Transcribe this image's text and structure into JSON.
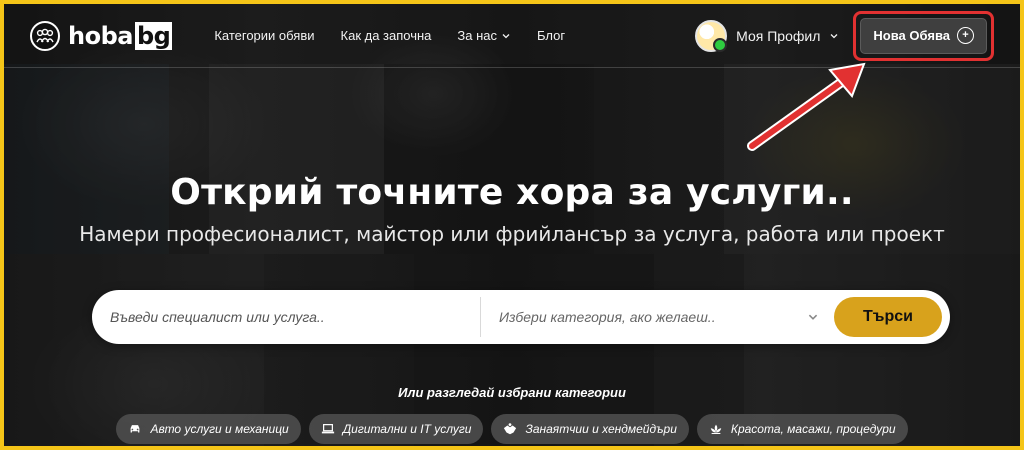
{
  "brand": {
    "logo_pre": "hoba",
    "logo_tag": "bg"
  },
  "nav": {
    "items": [
      {
        "label": "Категории обяви"
      },
      {
        "label": "Как да започна"
      },
      {
        "label": "За нас"
      },
      {
        "label": "Блог"
      }
    ],
    "profile_label": "Моя Профил",
    "new_ad_label": "Нова Обява"
  },
  "hero": {
    "headline": "Открий точните хора за услуги..",
    "subline": "Намери професионалист, майстор или фрийлансър за услуга, работа или проект"
  },
  "search": {
    "placeholder": "Въведи специалист или услуга..",
    "category_placeholder": "Избери категория, ако желаеш..",
    "button_label": "Търси"
  },
  "featured": {
    "heading": "Или разгледай избрани категории",
    "categories": [
      {
        "label": "Авто услуги и механици",
        "icon": "car-icon"
      },
      {
        "label": "Дигитални и IT услуги",
        "icon": "laptop-icon"
      },
      {
        "label": "Занаятчии и хендмейдъри",
        "icon": "handshake-icon"
      },
      {
        "label": "Красота, масажи, процедури",
        "icon": "lotus-icon"
      }
    ]
  },
  "colors": {
    "frame": "#f5c518",
    "accent": "#d8a21c",
    "annotation": "#e23131",
    "online": "#2ecc40"
  }
}
